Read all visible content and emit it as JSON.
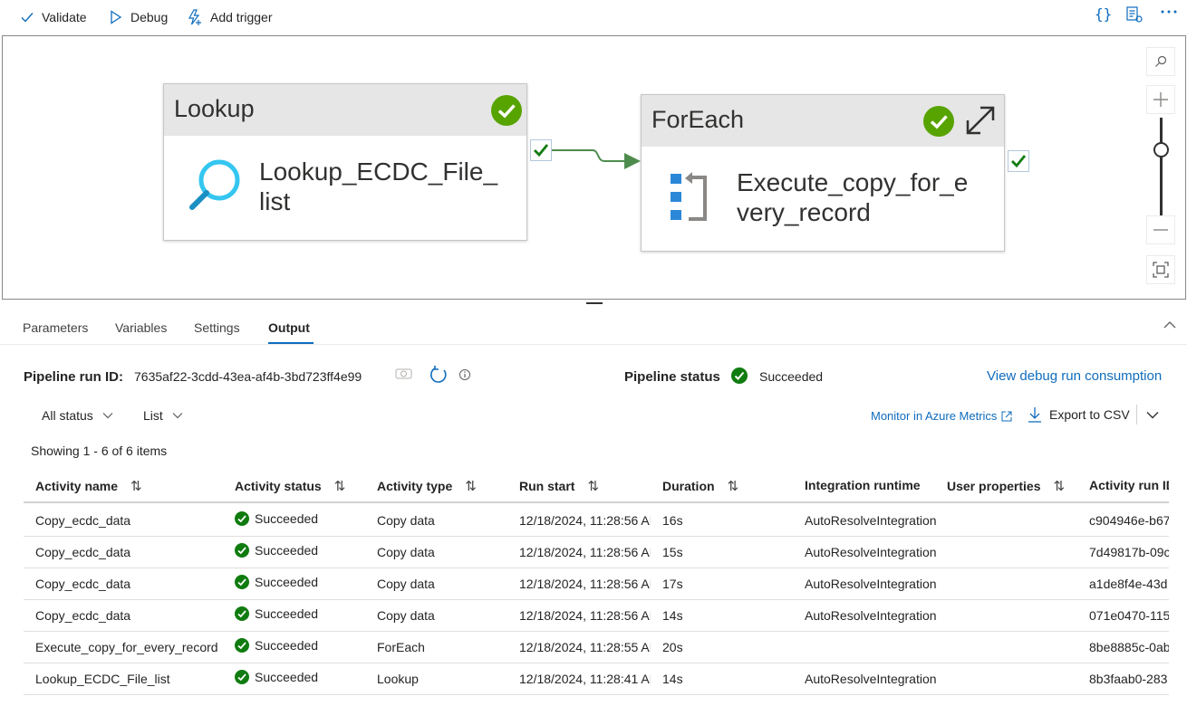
{
  "toolbar": {
    "validate_label": "Validate",
    "debug_label": "Debug",
    "add_trigger_label": "Add trigger",
    "code_icon": "{}"
  },
  "canvas": {
    "lookup": {
      "type": "Lookup",
      "name_line1": "Lookup_ECDC_File_",
      "name_line2": "list"
    },
    "foreach": {
      "type": "ForEach",
      "name_line1": "Execute_copy_for_e",
      "name_line2": "very_record"
    }
  },
  "tabs": [
    "Parameters",
    "Variables",
    "Settings",
    "Output"
  ],
  "output": {
    "run_id_label": "Pipeline run ID:",
    "run_id_value": "7635af22-3cdd-43ea-af4b-3bd723ff4e99",
    "status_label": "Pipeline status",
    "status_value": "Succeeded",
    "view_consumption": "View debug run consumption",
    "filter_status": "All status",
    "filter_view": "List",
    "monitor_link": "Monitor in Azure Metrics",
    "export_label": "Export to CSV",
    "showing": "Showing 1 - 6 of 6 items"
  },
  "table": {
    "headers": [
      "Activity name",
      "Activity status",
      "Activity type",
      "Run start",
      "Duration",
      "Integration runtime",
      "User properties",
      "Activity run ID"
    ],
    "rows": [
      [
        "Copy_ecdc_data",
        "Succeeded",
        "Copy data",
        "12/18/2024, 11:28:56 AM",
        "16s",
        "AutoResolveIntegrationRuntime",
        "",
        "c904946e-b67"
      ],
      [
        "Copy_ecdc_data",
        "Succeeded",
        "Copy data",
        "12/18/2024, 11:28:56 AM",
        "15s",
        "AutoResolveIntegrationRuntime",
        "",
        "7d49817b-09c"
      ],
      [
        "Copy_ecdc_data",
        "Succeeded",
        "Copy data",
        "12/18/2024, 11:28:56 AM",
        "17s",
        "AutoResolveIntegrationRuntime",
        "",
        "a1de8f4e-43d"
      ],
      [
        "Copy_ecdc_data",
        "Succeeded",
        "Copy data",
        "12/18/2024, 11:28:56 AM",
        "14s",
        "AutoResolveIntegrationRuntime",
        "",
        "071e0470-115"
      ],
      [
        "Execute_copy_for_every_record",
        "Succeeded",
        "ForEach",
        "12/18/2024, 11:28:55 AM",
        "20s",
        "",
        "",
        "8be8885c-0ab"
      ],
      [
        "Lookup_ECDC_File_list",
        "Succeeded",
        "Lookup",
        "12/18/2024, 11:28:41 AM",
        "14s",
        "AutoResolveIntegrationRuntime",
        "",
        "8b3faab0-283"
      ]
    ]
  }
}
